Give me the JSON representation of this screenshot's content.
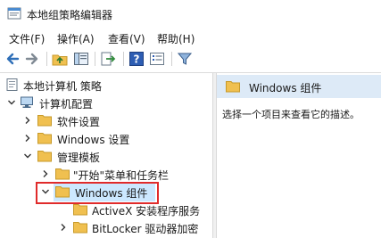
{
  "window": {
    "title": "本地组策略编辑器"
  },
  "menu": [
    {
      "label": "文件(F)"
    },
    {
      "label": "操作(A)"
    },
    {
      "label": "查看(V)"
    },
    {
      "label": "帮助(H)"
    }
  ],
  "toolbar": {
    "buttons": [
      "back-arrow-icon",
      "forward-arrow-icon",
      "up-folder-icon",
      "show-hide-tree-icon",
      "export-list-icon",
      "help-icon",
      "properties-icon",
      "filter-icon"
    ]
  },
  "tree": {
    "root": "本地计算机 策略",
    "computer_config": "计算机配置",
    "software_settings": "软件设置",
    "windows_settings": "Windows 设置",
    "admin_templates": "管理模板",
    "start_menu": "\"开始\"菜单和任务栏",
    "windows_components": "Windows 组件",
    "activex": "ActiveX 安装程序服务",
    "bitlocker": "BitLocker 驱动器加密"
  },
  "right_pane": {
    "header": "Windows 组件",
    "description": "选择一个项目来查看它的描述。"
  },
  "colors": {
    "selection": "#cce8ff",
    "highlight_box": "#e02b2b",
    "folder": "#f0c050",
    "header_bg": "#ddeaf7"
  }
}
